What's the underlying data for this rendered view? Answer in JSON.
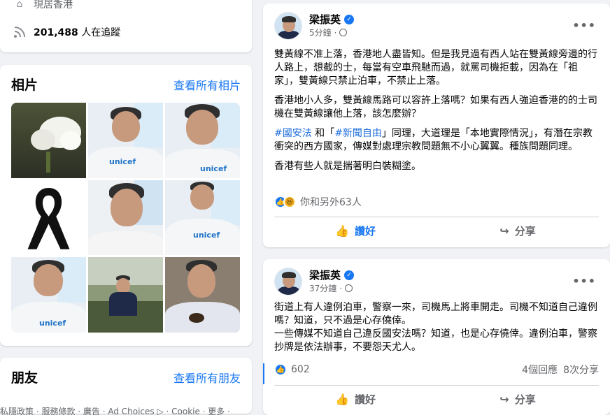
{
  "intro": {
    "location": "現居香港",
    "followers": "201,488",
    "followers_suffix": "人在追蹤"
  },
  "photos": {
    "title": "相片",
    "see_all": "查看所有相片",
    "tiles": [
      {
        "kind": "flowers"
      },
      {
        "kind": "unicef",
        "logo": "unicef"
      },
      {
        "kind": "unicef",
        "logo": "unicef"
      },
      {
        "kind": "ribbon"
      },
      {
        "kind": "portrait"
      },
      {
        "kind": "unicef",
        "logo": "unicef"
      },
      {
        "kind": "unicef",
        "logo": "unicef"
      },
      {
        "kind": "garden"
      },
      {
        "kind": "tea"
      }
    ]
  },
  "friends": {
    "title": "朋友",
    "see_all": "查看所有朋友"
  },
  "footer": {
    "text": "私隱政策 · 服務條款 · 廣告 · Ad Choices ▷ · Cookie · 更多 ·"
  },
  "post1": {
    "author": "梁振英",
    "time": "5分鐘",
    "para1": "雙黃線不准上落，香港地人盡皆知。但是我見過有西人站在雙黃線旁邊的行人路上，想截的士，每當有空車飛馳而過，就罵司機拒載，因為在「祖家」，雙黃線只禁止泊車，不禁止上落。",
    "para2": "香港地小人多，雙黃線馬路可以容許上落嗎？如果有西人強迫香港的的士司機在雙黃線讓他上落，該怎麼辦？",
    "tag1": "#國安法",
    "and": " 和「",
    "tag2": "#新聞自由",
    "para3_rest": "」同理，大道理是「本地實際情況」，有潛在宗教衝突的西方國家，傳媒對處理宗教問題無不小心翼翼。種族問題同理。",
    "para4": "香港有些人就是揣著明白裝糊塗。",
    "reactions_text": "你和另外63人",
    "like_label": "讚好",
    "share_label": "分享"
  },
  "post2": {
    "author": "梁振英",
    "time": "37分鐘",
    "para1": "街道上有人違例泊車，警察一來，司機馬上將車開走。司機不知道自己違例嗎？知道，只不過是心存僥倖。",
    "para2": "一些傳媒不知道自己違反國安法嗎？知道，也是心存僥倖。違例泊車，警察抄牌是依法辦事，不要怨天尤人。",
    "reaction_count": "602",
    "comments": "4個回應",
    "shares": "8次分享",
    "like_label": "讚好",
    "share_label": "分享"
  }
}
